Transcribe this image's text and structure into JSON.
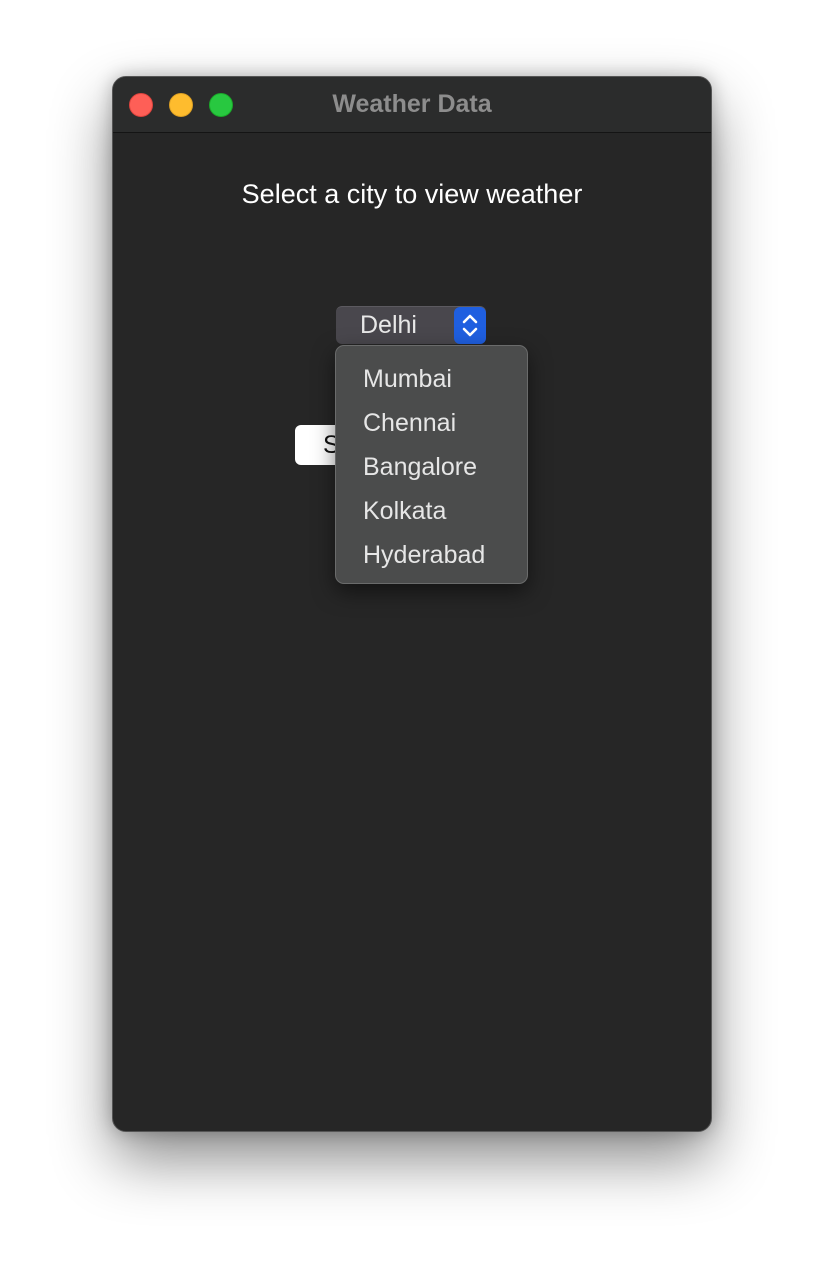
{
  "window": {
    "title": "Weather Data"
  },
  "main": {
    "heading": "Select a city to view weather",
    "city_select": {
      "selected": "Delhi",
      "options": [
        "Mumbai",
        "Chennai",
        "Bangalore",
        "Kolkata",
        "Hyderabad"
      ]
    },
    "action_button_label": "S"
  },
  "colors": {
    "window_bg": "#262626",
    "accent": "#1f5fe0",
    "menu_bg": "#4b4c4c"
  },
  "icons": {
    "stepper": "chevron-up-down-icon"
  }
}
